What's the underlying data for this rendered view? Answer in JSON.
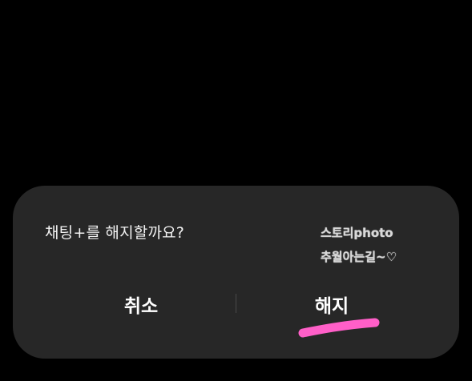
{
  "dialog": {
    "message": "채팅+를 해지할까요?",
    "cancel_label": "취소",
    "confirm_label": "해지"
  },
  "watermark": {
    "line1": "스토리photo",
    "line2": "추월아는길~♡"
  },
  "colors": {
    "background": "#000000",
    "dialog": "#272727",
    "text": "#f2f2f2",
    "highlight": "#ff5fc8"
  }
}
